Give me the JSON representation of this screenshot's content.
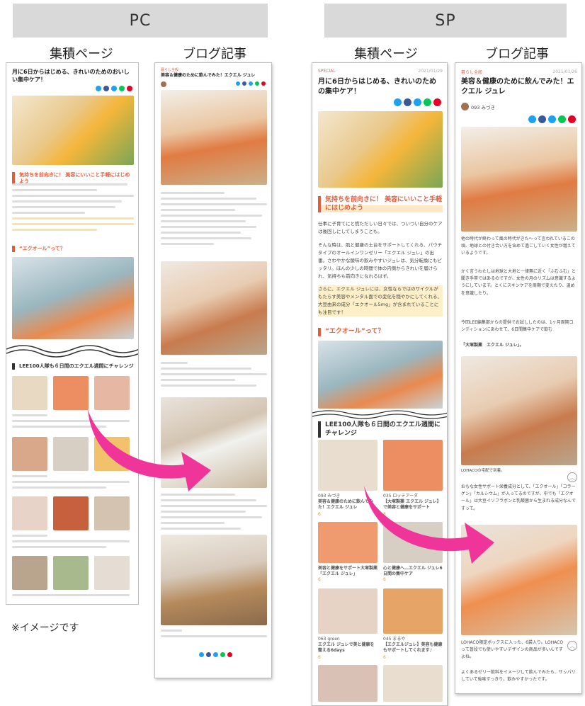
{
  "header": {
    "pc_label": "PC",
    "sp_label": "SP"
  },
  "columns": {
    "archive": "集積ページ",
    "blog": "ブログ記事"
  },
  "note": "※イメージです",
  "pc_archive": {
    "title": "月に6日からはじめる、きれいのためのおいしい集中ケア！",
    "heading1": "気持ちを前向きに！ 美容にいいこと手軽にはじめよう",
    "heading2": "“エクオール”って？",
    "section_title": "LEE100人隊も６日間のエクエル週間にチャレンジ"
  },
  "pc_blog": {
    "category": "暮らし全般",
    "title": "美容＆健康のために飲んでみた！エクエル ジュレ"
  },
  "sp_archive": {
    "category": "SPECIAL",
    "date": "2021/01/29",
    "title": "月に6日からはじめる、きれいのための集中ケア！",
    "heading1": "気持ちを前向きに！ 美容にいいこと手軽にはじめよう",
    "p1": "仕事に子育てにと慌ただしい日々では、ついつい自分のケアは後回しにしてしまうことも。",
    "p2": "そんな時は、肌と健康の土台をサポートしてくれる、パウチタイプのオールインワンゼリー「エクエル ジュレ」の出番。さわやかな酸味の飲みやすいジュレは、気分転換にもピッタリ。ほんの少しの時間で体の内側からきれいを届けられ、気持ちも前向きになれるはず。",
    "p3": "さらに、エクエル ジュレには、女性ならではのサイクルがもたらす美容やメンタル面での変化を穏やかにしてくれる、大豆由来の成分「エクオール5mg」が含まれていることにも注目です！",
    "heading2": "“エクオール”って？",
    "section_title": "LEE100人隊も６日間のエクエル週間にチャレンジ",
    "cards": [
      {
        "author": "093 みづき",
        "title": "美容＆健康のために飲んでみた！エクエル ジュレ",
        "likes": "6"
      },
      {
        "author": "035 ロッテアーダ",
        "title": "【大塚製薬 エクエル ジュレ】で美容と健康をサポート",
        "likes": "8"
      },
      {
        "author": "",
        "title": "美容と健康をサポート大塚製薬「エクエル ジュレ」",
        "likes": "6"
      },
      {
        "author": "",
        "title": "心と健康へ…エクエル ジュレ6日間の集中ケア",
        "likes": "6"
      },
      {
        "author": "063 green",
        "title": "エクエル ジュレで美と健康を整える6days",
        "likes": "6"
      },
      {
        "author": "045 まるや",
        "title": "【エクエルジュレ】美容も健康もサポートしてくれます♪",
        "likes": "6"
      }
    ]
  },
  "sp_blog": {
    "category": "暮らし全般",
    "date": "2021/01/26",
    "title": "美容＆健康のために飲んでみた！エクエル ジュレ",
    "author": "093 みづき",
    "p1": "他の時代が終わって風の時代がきた〜って言われているこの頃、地球との付き合い方を含めて過ごしていく女性が増えているようです。",
    "p2": "かく言うわたしは地球と大地と一律無に近く「ふむふむ」と聞き手帯ではあるのですが、女性の月のリズムは意識するようにしています。とくにスキンケアを周期で変えたり、温めを意識したり。",
    "p3a": "今回LEE編集部からの提供でお試ししたのは、1ヶ月周期コンディションにあわせて、6日間集中ケアで飲む",
    "p3b": "「大塚製薬　エクエル ジュレ」。",
    "caption1": "LOHACOの宅配で到着。",
    "p4": "おもな女性サポート栄養成分として、「エクオール」「コラーゲン」「カルシウム」が入ってるのですが、中でも「エクオール」は大豆イソフラボンと乳酸菌から生まれる成分なんですって。",
    "p5": "LOHACO限定ボックスに入った、6袋入り。LOHACOって普段でも使いやすいデザインの商品が多いんですよね。",
    "p6": "よくあるゼリー飲料をイメージして飲んでみたら、サッパリしていて後味すっきり。飲みやすかったです。"
  },
  "colors": {
    "accent": "#e35d3d",
    "arrow": "#f0359a",
    "bar": "#d9d9d9"
  }
}
